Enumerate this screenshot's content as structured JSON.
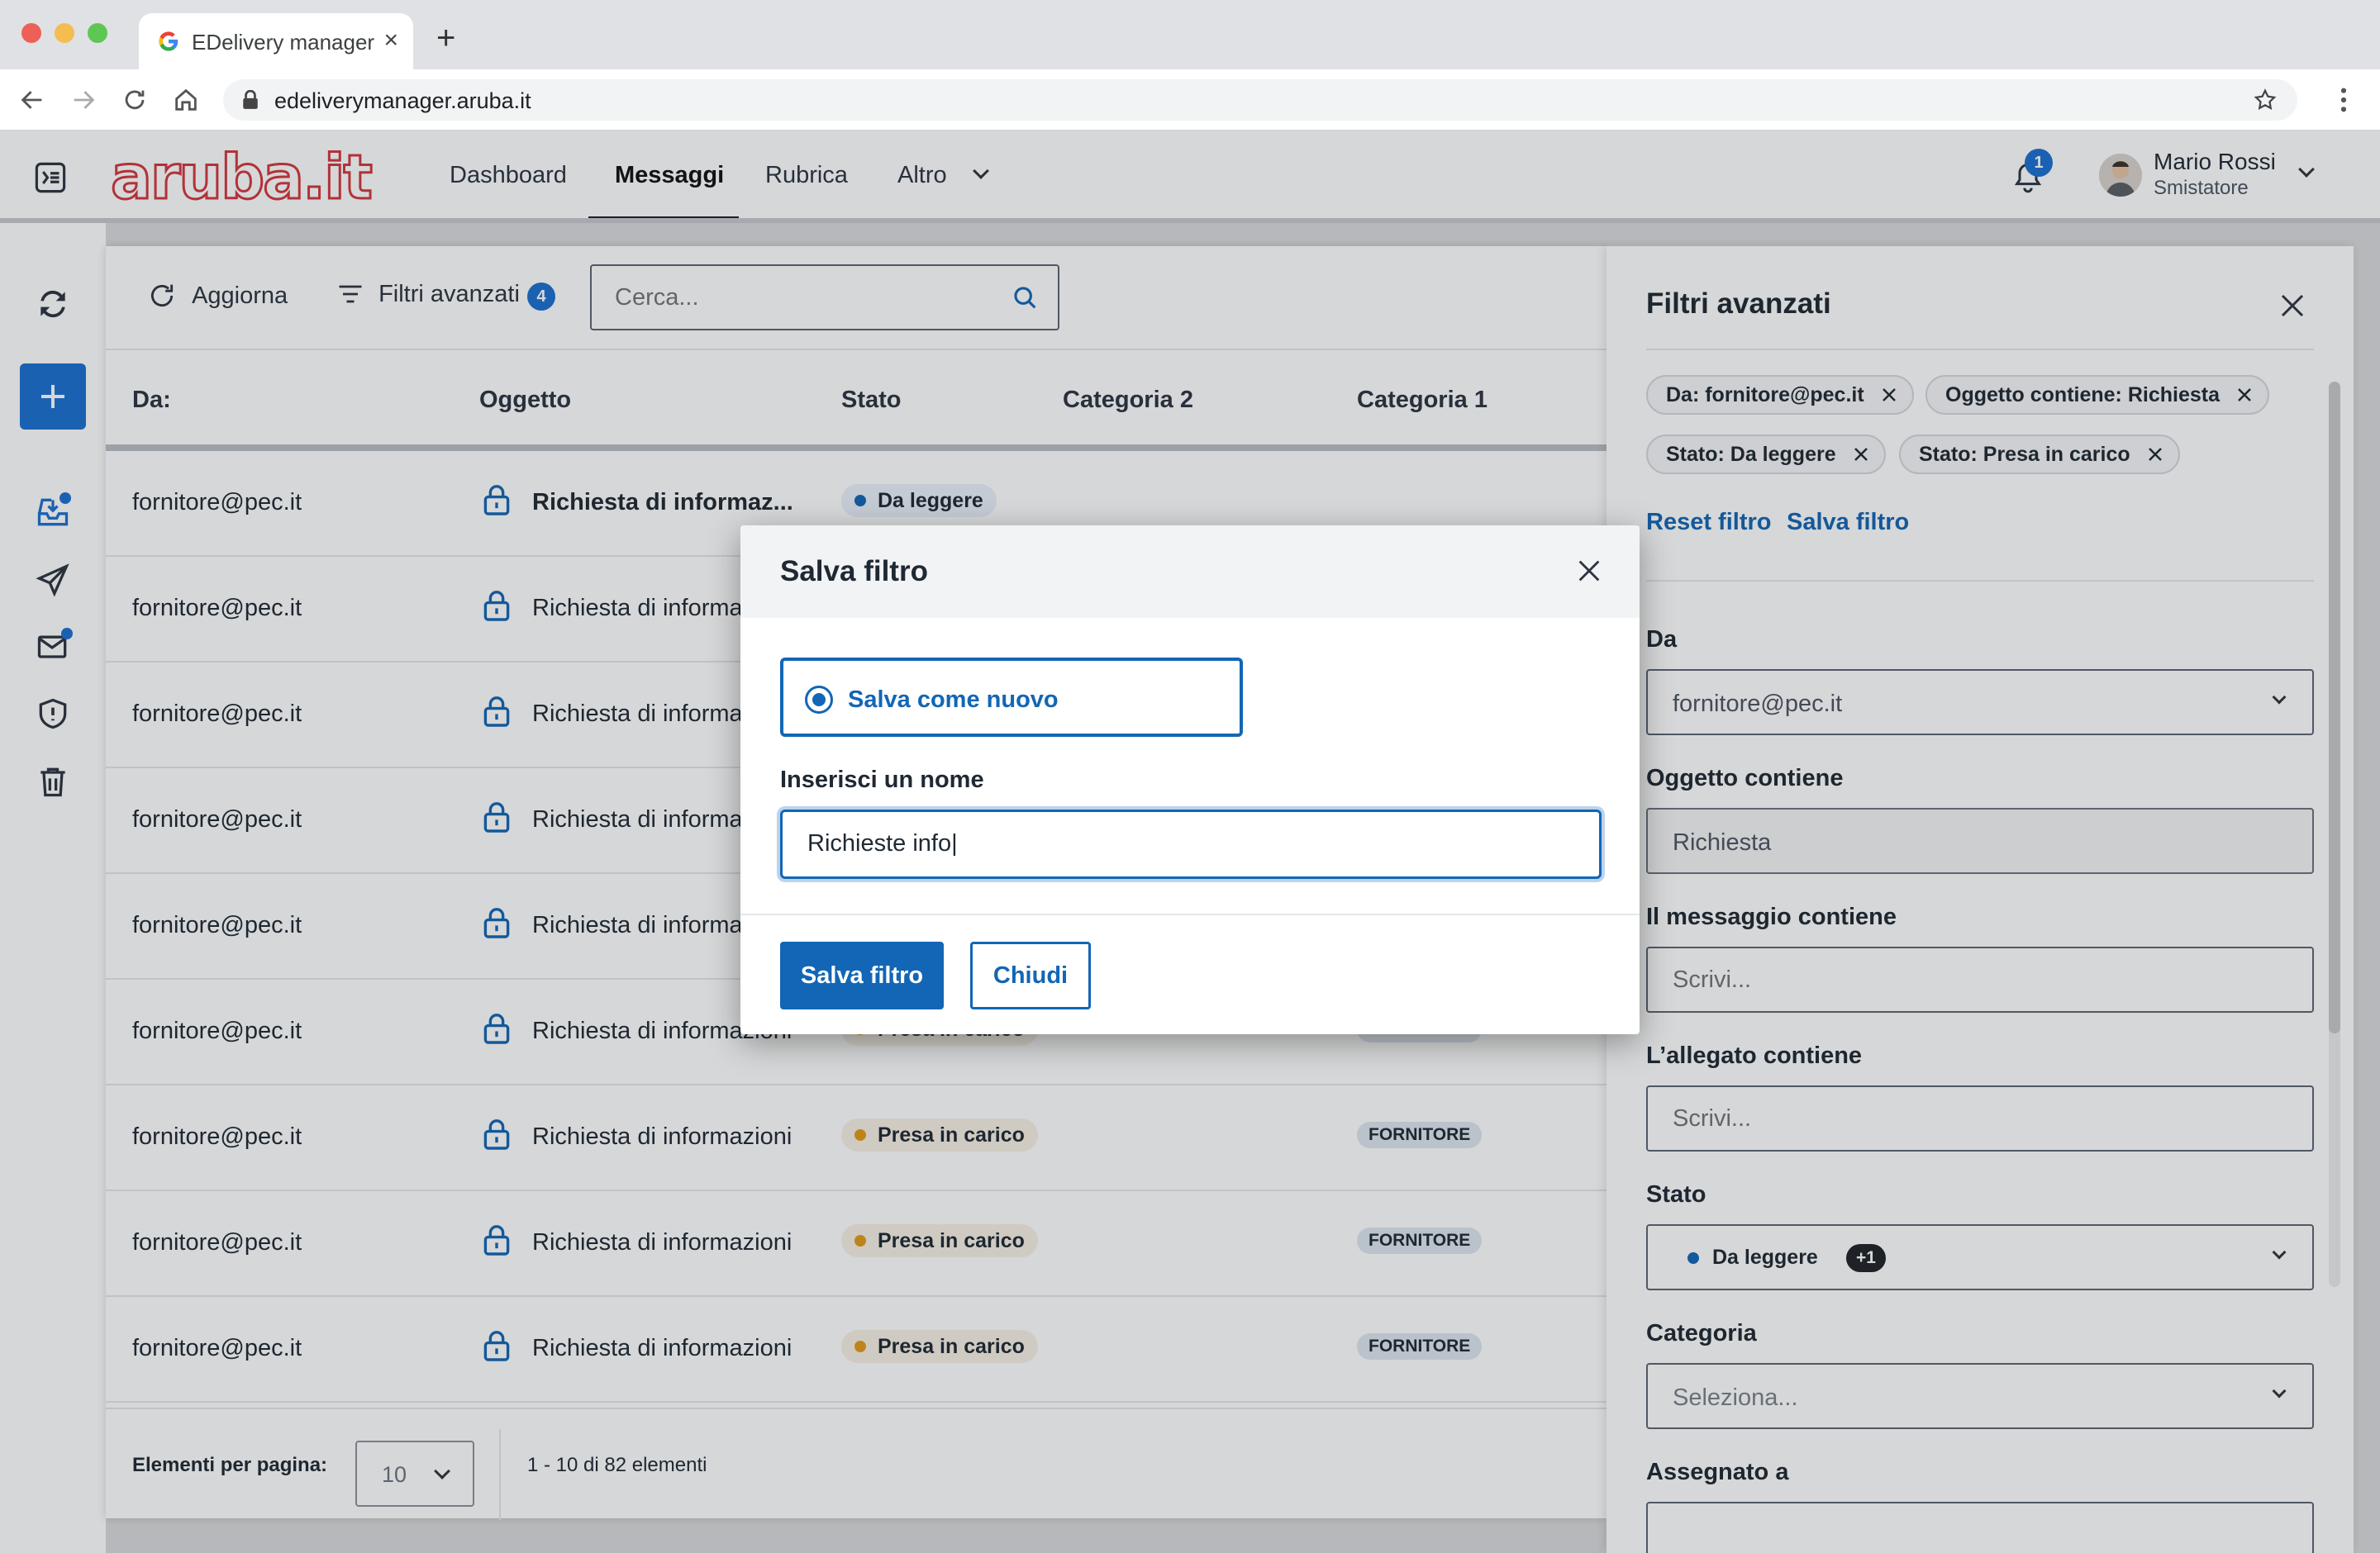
{
  "browser": {
    "tab_title": "EDelivery manager",
    "url": "edeliverymanager.aruba.it"
  },
  "header": {
    "logo_text": "aruba.it",
    "nav": [
      {
        "label": "Dashboard"
      },
      {
        "label": "Messaggi"
      },
      {
        "label": "Rubrica"
      },
      {
        "label": "Altro"
      }
    ],
    "active_nav": "Messaggi",
    "notifications_count": "1",
    "user_name": "Mario Rossi",
    "user_role": "Smistatore"
  },
  "toolbar": {
    "refresh_label": "Aggiorna",
    "filters_label": "Filtri avanzati",
    "filters_count": "4",
    "search_placeholder": "Cerca..."
  },
  "table": {
    "columns": [
      "Da:",
      "Oggetto",
      "Stato",
      "Categoria 2",
      "Categoria 1"
    ],
    "rows": [
      {
        "from": "fornitore@pec.it",
        "subject": "Richiesta di informaz...",
        "bold": true,
        "status": "Da leggere",
        "category1": ""
      },
      {
        "from": "fornitore@pec.it",
        "subject": "Richiesta di informaz",
        "bold": false,
        "status": "",
        "category1": ""
      },
      {
        "from": "fornitore@pec.it",
        "subject": "Richiesta di informaz",
        "bold": false,
        "status": "",
        "category1": ""
      },
      {
        "from": "fornitore@pec.it",
        "subject": "Richiesta di informaz",
        "bold": false,
        "status": "",
        "category1": ""
      },
      {
        "from": "fornitore@pec.it",
        "subject": "Richiesta di informaz",
        "bold": false,
        "status": "",
        "category1": ""
      },
      {
        "from": "fornitore@pec.it",
        "subject": "Richiesta di informazioni",
        "bold": false,
        "status": "Presa in carico",
        "category1": "FORNITORE"
      },
      {
        "from": "fornitore@pec.it",
        "subject": "Richiesta di informazioni",
        "bold": false,
        "status": "Presa in carico",
        "category1": "FORNITORE"
      },
      {
        "from": "fornitore@pec.it",
        "subject": "Richiesta di informazioni",
        "bold": false,
        "status": "Presa in carico",
        "category1": "FORNITORE"
      },
      {
        "from": "fornitore@pec.it",
        "subject": "Richiesta di informazioni",
        "bold": false,
        "status": "Presa in carico",
        "category1": "FORNITORE"
      }
    ]
  },
  "pager": {
    "label": "Elementi per pagina:",
    "page_size": "10",
    "count": "1 - 10 di 82 elementi"
  },
  "filters_panel": {
    "title": "Filtri avanzati",
    "chips": [
      "Da: fornitore@pec.it",
      "Oggetto contiene: Richiesta",
      "Stato: Da leggere",
      "Stato: Presa in carico"
    ],
    "reset_label": "Reset filtro",
    "save_label": "Salva filtro",
    "fields": {
      "from_label": "Da",
      "from_value": "fornitore@pec.it",
      "subject_label": "Oggetto contiene",
      "subject_value": "Richiesta",
      "message_label": "Il messaggio contiene",
      "message_placeholder": "Scrivi...",
      "attachment_label": "L’allegato contiene",
      "attachment_placeholder": "Scrivi...",
      "state_label": "Stato",
      "state_value": "Da leggere",
      "state_more": "+1",
      "category_label": "Categoria",
      "category_placeholder": "Seleziona...",
      "assigned_label": "Assegnato a"
    },
    "scroll_fraction": 0.72
  },
  "modal": {
    "title": "Salva filtro",
    "option_label": "Salva come nuovo",
    "name_label": "Inserisci un nome",
    "name_value": "Richieste info|",
    "save_button": "Salva filtro",
    "close_button": "Chiudi"
  },
  "colors": {
    "primary": "#1266b5",
    "badge": "#1b6fd1",
    "brand_red": "#d2363e",
    "status_new": "#1266b5",
    "status_taken": "#e39a17"
  }
}
